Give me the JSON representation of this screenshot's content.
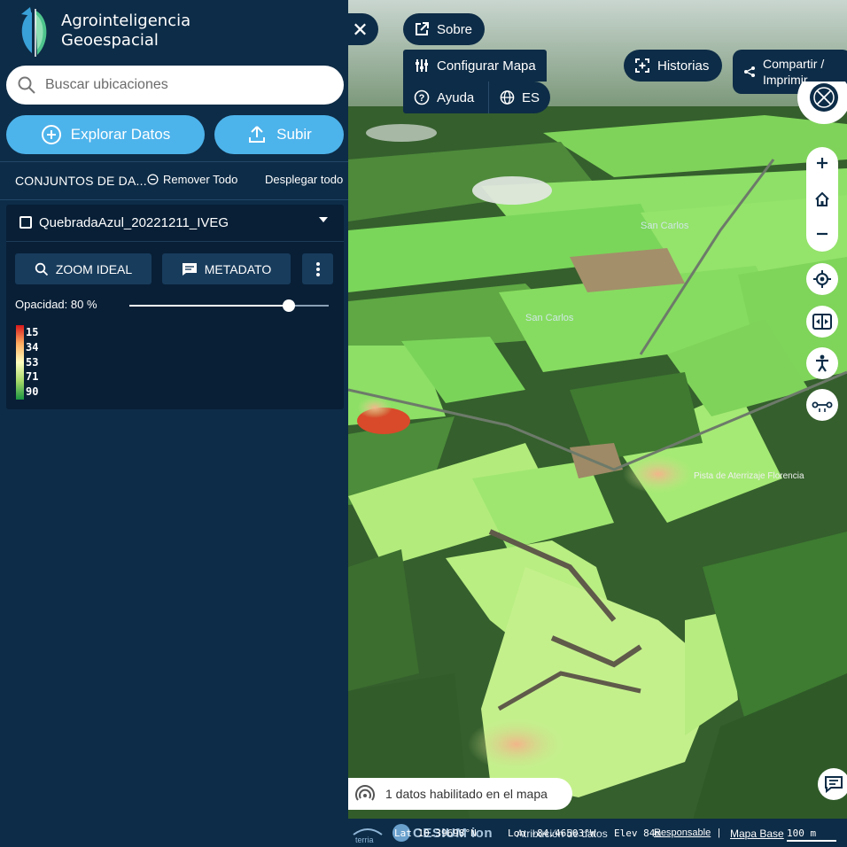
{
  "brand": {
    "line1": "Agrointeligencia",
    "line2": "Geoespacial"
  },
  "search": {
    "placeholder": "Buscar ubicaciones"
  },
  "actions": {
    "explore": "Explorar Datos",
    "upload": "Subir"
  },
  "datasets": {
    "title": "CONJUNTOS DE DA...",
    "remove_all": "Remover Todo",
    "expand_all": "Desplegar todo"
  },
  "workbench": {
    "item_name": "QuebradaAzul_20221211_IVEG",
    "zoom_label": "ZOOM IDEAL",
    "metadata_label": "METADATO",
    "opacity_label": "Opacidad: 80 %",
    "opacity_value": 0.8,
    "legend": [
      "15",
      "34",
      "53",
      "71",
      "90"
    ]
  },
  "map_buttons": {
    "about": "Sobre",
    "configure": "Configurar Mapa",
    "help": "Ayuda",
    "language": "ES",
    "stories": "Historias",
    "share_line1": "Compartir /",
    "share_line2": "Imprimir"
  },
  "map_labels": [
    "San Carlos",
    "San Carlos",
    "Pista de Aterrizaje Florencia"
  ],
  "footer": {
    "enabled_text": "1 datos habilitado en el mapa"
  },
  "status": {
    "lat": "Lat 10.39698°N",
    "lon": "Lon -84.46503°W",
    "elev": "Elev 84m",
    "attribution": "Atribución de datos",
    "disclaimer": "Responsable",
    "basemap": "Mapa Base",
    "scale": "100 m",
    "cesium": "CESIUM ion"
  },
  "colors": {
    "panel": "#0d2c47",
    "accent": "#4db3eb",
    "workbench": "#081f36"
  }
}
